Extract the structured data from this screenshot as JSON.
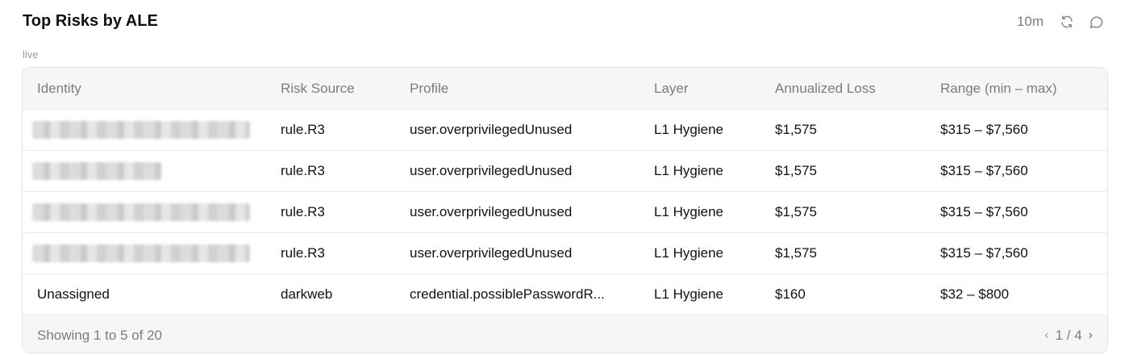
{
  "widget": {
    "title": "Top Risks by ALE",
    "status": "live",
    "refresh_interval": "10m",
    "icons": [
      "refresh-icon",
      "comment-icon"
    ]
  },
  "table": {
    "columns": [
      "Identity",
      "Risk Source",
      "Profile",
      "Layer",
      "Annualized Loss",
      "Range (min – max)"
    ],
    "rows": [
      {
        "identity": "",
        "identity_redacted": true,
        "risk_source": "rule.R3",
        "profile": "user.overprivilegedUnused",
        "layer": "L1 Hygiene",
        "annualized_loss": "$1,575",
        "range": "$315 – $7,560"
      },
      {
        "identity": "",
        "identity_redacted": true,
        "risk_source": "rule.R3",
        "profile": "user.overprivilegedUnused",
        "layer": "L1 Hygiene",
        "annualized_loss": "$1,575",
        "range": "$315 – $7,560"
      },
      {
        "identity": "",
        "identity_redacted": true,
        "risk_source": "rule.R3",
        "profile": "user.overprivilegedUnused",
        "layer": "L1 Hygiene",
        "annualized_loss": "$1,575",
        "range": "$315 – $7,560"
      },
      {
        "identity": "",
        "identity_redacted": true,
        "risk_source": "rule.R3",
        "profile": "user.overprivilegedUnused",
        "layer": "L1 Hygiene",
        "annualized_loss": "$1,575",
        "range": "$315 – $7,560"
      },
      {
        "identity": "Unassigned",
        "identity_redacted": false,
        "risk_source": "darkweb",
        "profile": "credential.possiblePasswordR...",
        "layer": "L1 Hygiene",
        "annualized_loss": "$160",
        "range": "$32 – $800"
      }
    ]
  },
  "footer": {
    "summary": "Showing 1 to 5 of 20",
    "page_indicator": "1 / 4",
    "prev_symbol": "‹",
    "next_symbol": "›"
  }
}
